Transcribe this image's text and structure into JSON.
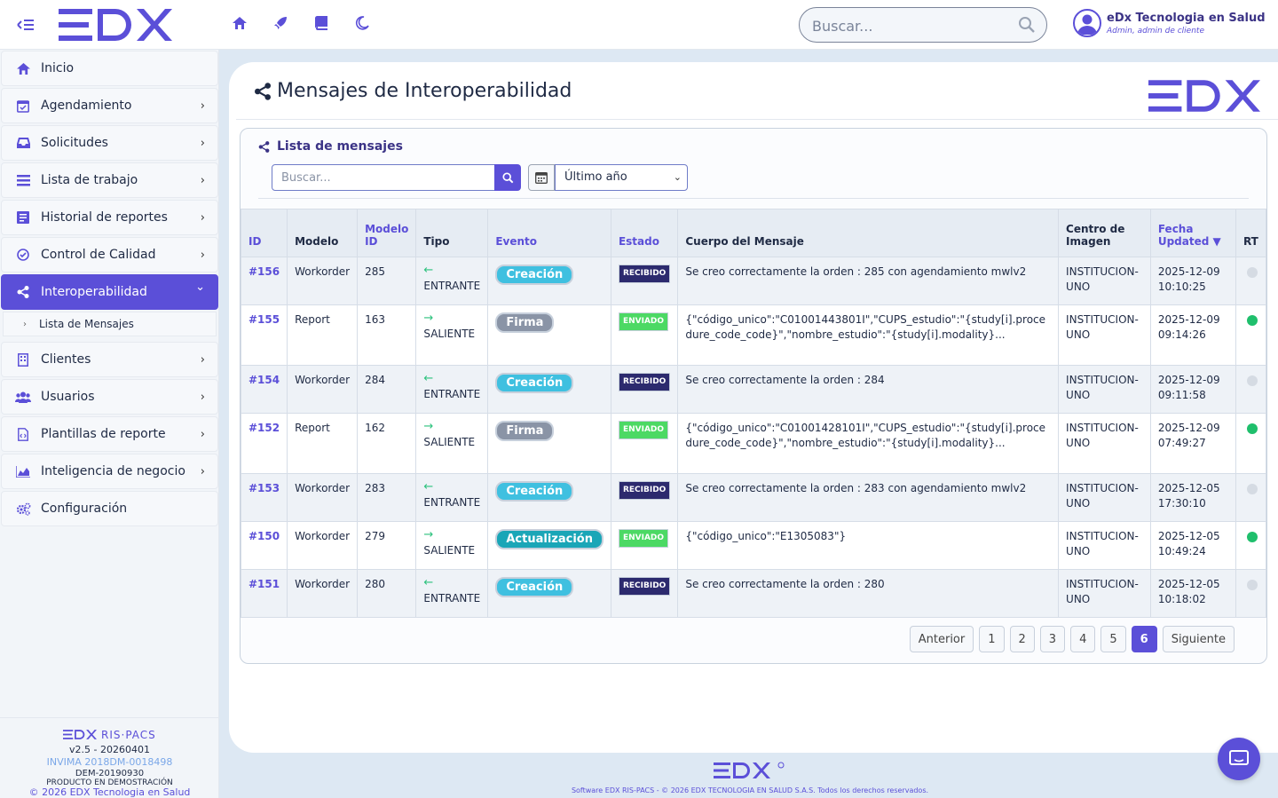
{
  "header": {
    "search_placeholder": "Buscar...",
    "user_name": "eDx Tecnologia en Salud",
    "user_role": "Admin, admin de cliente",
    "top_icons": [
      "home-icon",
      "rocket-icon",
      "book-icon",
      "moon-icon"
    ]
  },
  "sidebar": {
    "items": [
      {
        "label": "Inicio",
        "icon": "home-icon",
        "chevron": ""
      },
      {
        "label": "Agendamiento",
        "icon": "calendar-icon",
        "chevron": "›"
      },
      {
        "label": "Solicitudes",
        "icon": "inbox-icon",
        "chevron": "›"
      },
      {
        "label": "Lista de trabajo",
        "icon": "list-icon",
        "chevron": "›"
      },
      {
        "label": "Historial de reportes",
        "icon": "report-icon",
        "chevron": "›"
      },
      {
        "label": "Control de Calidad",
        "icon": "check-circle-icon",
        "chevron": "›"
      },
      {
        "label": "Interoperabilidad",
        "icon": "share-icon",
        "chevron": "⌄"
      },
      {
        "label": "Clientes",
        "icon": "building-icon",
        "chevron": "›"
      },
      {
        "label": "Usuarios",
        "icon": "users-icon",
        "chevron": "›"
      },
      {
        "label": "Plantillas de reporte",
        "icon": "file-code-icon",
        "chevron": "›"
      },
      {
        "label": "Inteligencia de negocio",
        "icon": "area-chart-icon",
        "chevron": "›"
      },
      {
        "label": "Configuración",
        "icon": "cogs-icon",
        "chevron": ""
      }
    ],
    "sub_item": "Lista de Mensajes",
    "footer": {
      "brand": "RIS·PACS",
      "version": "v2.5 - 20260401",
      "invima": "INVIMA 2018DM-0018498",
      "dem": "DEM-20190930",
      "product": "PRODUCTO EN DEMOSTRACIÓN",
      "copyright": "© 2026 EDX Tecnologia en Salud"
    }
  },
  "page": {
    "title": "Mensajes de Interoperabilidad",
    "panel_title": "Lista de mensajes",
    "search_placeholder": "Buscar...",
    "range": "Último año"
  },
  "table": {
    "headers": {
      "id": "ID",
      "modelo": "Modelo",
      "modelo_id": "Modelo ID",
      "tipo": "Tipo",
      "evento": "Evento",
      "estado": "Estado",
      "cuerpo": "Cuerpo del Mensaje",
      "centro": "Centro de Imagen",
      "fecha": "Fecha Updated ▼",
      "rt": "RT"
    },
    "rows": [
      {
        "id": "#156",
        "modelo": "Workorder",
        "modelo_id": "285",
        "arrow": "←",
        "tipo": "ENTRANTE",
        "evento": "Creación",
        "estado": "RECIBIDO",
        "cuerpo": "Se creo correctamente la orden : 285 con agendamiento mwlv2",
        "centro": "INSTITUCION-UNO",
        "fecha": "2025-12-09 10:10:25",
        "rt": false
      },
      {
        "id": "#155",
        "modelo": "Report",
        "modelo_id": "163",
        "arrow": "→",
        "tipo": "SALIENTE",
        "evento": "Firma",
        "estado": "ENVIADO",
        "cuerpo": "{\"código_unico\":\"C01001443801I\",\"CUPS_estudio\":\"{study[i].procedure_code_code}\",\"nombre_estudio\":\"{study[i].modality}...",
        "centro": "INSTITUCION-UNO",
        "fecha": "2025-12-09 09:14:26",
        "rt": true
      },
      {
        "id": "#154",
        "modelo": "Workorder",
        "modelo_id": "284",
        "arrow": "←",
        "tipo": "ENTRANTE",
        "evento": "Creación",
        "estado": "RECIBIDO",
        "cuerpo": "Se creo correctamente la orden : 284",
        "centro": "INSTITUCION-UNO",
        "fecha": "2025-12-09 09:11:58",
        "rt": false
      },
      {
        "id": "#152",
        "modelo": "Report",
        "modelo_id": "162",
        "arrow": "→",
        "tipo": "SALIENTE",
        "evento": "Firma",
        "estado": "ENVIADO",
        "cuerpo": "{\"código_unico\":\"C01001428101I\",\"CUPS_estudio\":\"{study[i].procedure_code_code}\",\"nombre_estudio\":\"{study[i].modality}...",
        "centro": "INSTITUCION-UNO",
        "fecha": "2025-12-09 07:49:27",
        "rt": true
      },
      {
        "id": "#153",
        "modelo": "Workorder",
        "modelo_id": "283",
        "arrow": "←",
        "tipo": "ENTRANTE",
        "evento": "Creación",
        "estado": "RECIBIDO",
        "cuerpo": "Se creo correctamente la orden : 283 con agendamiento mwlv2",
        "centro": "INSTITUCION-UNO",
        "fecha": "2025-12-05 17:30:10",
        "rt": false
      },
      {
        "id": "#150",
        "modelo": "Workorder",
        "modelo_id": "279",
        "arrow": "→",
        "tipo": "SALIENTE",
        "evento": "Actualización",
        "estado": "ENVIADO",
        "cuerpo": "{\"código_unico\":\"E1305083\"}",
        "centro": "INSTITUCION-UNO",
        "fecha": "2025-12-05 10:49:24",
        "rt": true
      },
      {
        "id": "#151",
        "modelo": "Workorder",
        "modelo_id": "280",
        "arrow": "←",
        "tipo": "ENTRANTE",
        "evento": "Creación",
        "estado": "RECIBIDO",
        "cuerpo": "Se creo correctamente la orden : 280",
        "centro": "INSTITUCION-UNO",
        "fecha": "2025-12-05 10:18:02",
        "rt": false
      }
    ]
  },
  "pagination": {
    "prev": "Anterior",
    "pages": [
      "1",
      "2",
      "3",
      "4",
      "5",
      "6"
    ],
    "current": "6",
    "next": "Siguiente"
  },
  "footer": {
    "text": "Software EDX RIS-PACS - © 2026 EDX TECNOLOGIA EN SALUD S.A.S. Todos los derechos reservados."
  },
  "colors": {
    "accent": "#5b4fd8",
    "received": "#2c2a6e",
    "sent": "#4cd964",
    "rt_active": "#1fbf6c"
  }
}
